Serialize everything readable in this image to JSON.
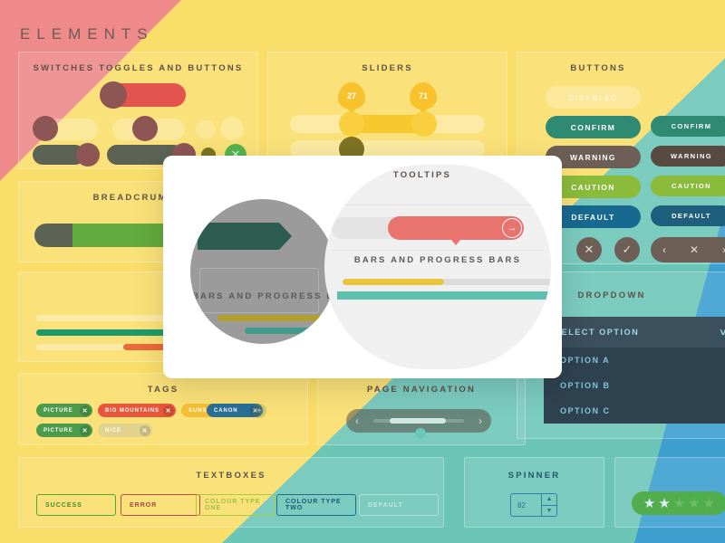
{
  "page": {
    "title": "ELEMENTS"
  },
  "palette": {
    "pink": "#ef8a8a",
    "yellow": "#fade6a",
    "teal": "#6cc6b8",
    "blue": "#3d9fd0",
    "red_accent": "#e8736f",
    "green_accent": "#52ad4c"
  },
  "sections": {
    "switches": {
      "title": "SWITCHES TOGGLES AND BUTTONS"
    },
    "sliders": {
      "title": "SLIDERS",
      "values": [
        27,
        71
      ],
      "bubbles": [
        "27",
        "71"
      ]
    },
    "buttons": {
      "title": "BUTTONS",
      "left_column": [
        "DISABLED",
        "CONFIRM",
        "WARNING",
        "CAUTION",
        "DEFAULT"
      ],
      "right_column": [
        "CONFIRM",
        "WARNING",
        "CAUTION",
        "DEFAULT"
      ],
      "icon_buttons": [
        "close-icon",
        "close-icon",
        "check-icon"
      ],
      "pill_group": [
        "chevron-left-icon",
        "close-icon",
        "chevron-right-icon"
      ]
    },
    "breadcrumbs": {
      "title": "BREADCRUMBS"
    },
    "progress": {
      "title": "BARS AND PROGRESS BARS"
    },
    "tooltips": {
      "title": "TOOLTIPS"
    },
    "dropdown": {
      "title": "DROPDOWN",
      "selected": "SELECT OPTION",
      "chevron": "chevron-down-icon",
      "options": [
        "OPTION A",
        "OPTION B",
        "OPTION C"
      ]
    },
    "tags": {
      "title": "TAGS",
      "row1": [
        {
          "label": "PICTURE",
          "color": "#4c9b4a"
        },
        {
          "label": "BIG MOUNTAINS",
          "color": "#e8563c"
        },
        {
          "label": "SUNSET",
          "color": "#f5c033"
        },
        {
          "label": "CANON",
          "color": "#2a6f96"
        }
      ],
      "row2": [
        {
          "label": "PICTURE",
          "color": "#4c9b4a"
        },
        {
          "label": "NICE",
          "color": "#d9cf94"
        }
      ],
      "add_label": "+"
    },
    "page_navigation": {
      "title": "PAGE NAVIGATION",
      "prev": "chevron-left-icon",
      "next": "chevron-right-icon"
    },
    "textboxes": {
      "title": "TEXTBOXES",
      "fields": [
        {
          "label": "SUCCESS",
          "color": "#4fa832"
        },
        {
          "label": "ERROR",
          "color": "#b8484e"
        },
        {
          "label": "COLOUR TYPE ONE",
          "color": "#a6ce39"
        },
        {
          "label": "COLOUR TYPE TWO",
          "color": "#1e6b8f"
        },
        {
          "label": "DEFAULT",
          "color": "#8aa9a6"
        }
      ]
    },
    "spinner": {
      "title": "SPINNER",
      "value": "82",
      "up": "chevron-up-icon",
      "down": "chevron-down-icon"
    },
    "rating": {
      "stars_total": 5,
      "stars_filled": 2,
      "star_glyph": "★"
    }
  }
}
